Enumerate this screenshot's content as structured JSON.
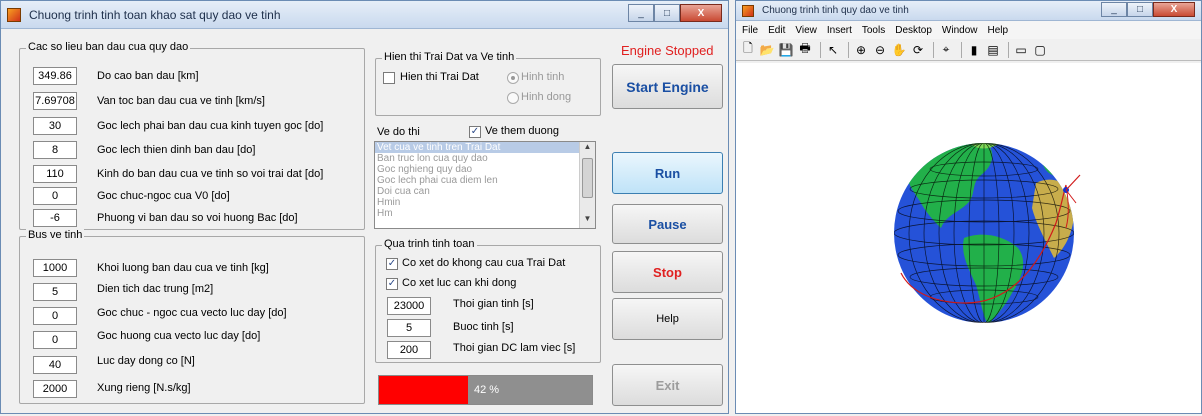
{
  "left_window": {
    "title": "Chuong trinh tinh toan khao sat quy dao ve tinh",
    "orbit_group": {
      "title": "Cac so lieu ban dau cua quy dao",
      "rows": [
        {
          "value": "349.86",
          "label": "Do cao ban dau [km]"
        },
        {
          "value": "7.69708",
          "label": "Van toc ban dau cua ve tinh [km/s]"
        },
        {
          "value": "30",
          "label": "Goc lech phai ban dau cua kinh tuyen goc [do]"
        },
        {
          "value": "8",
          "label": "Goc lech thien dinh ban dau [do]"
        },
        {
          "value": "110",
          "label": "Kinh do ban dau cua ve tinh so voi trai dat [do]"
        },
        {
          "value": "0",
          "label": "Goc chuc-ngoc cua V0 [do]"
        },
        {
          "value": "-6",
          "label": "Phuong vi ban dau so voi huong Bac [do]"
        }
      ]
    },
    "bus_group": {
      "title": "Bus ve tinh",
      "rows": [
        {
          "value": "1000",
          "label": "Khoi luong ban dau cua ve tinh [kg]"
        },
        {
          "value": "5",
          "label": "Dien tich dac trung [m2]"
        },
        {
          "value": "0",
          "label": "Goc chuc - ngoc cua vecto luc day [do]"
        },
        {
          "value": "0",
          "label": "Goc huong cua vecto luc day [do]"
        },
        {
          "value": "40",
          "label": "Luc day dong co [N]"
        },
        {
          "value": "2000",
          "label": "Xung rieng [N.s/kg]"
        }
      ]
    },
    "display_group": {
      "title": "Hien thi Trai Dat va Ve tinh",
      "show_earth": "Hien thi Trai Dat",
      "radio_static": "Hinh tinh",
      "radio_dynamic": "Hinh dong"
    },
    "plot_group": {
      "label": "Ve do thi",
      "overlay_check": "Ve them duong",
      "items": [
        "Vet cua ve tinh tren Trai Dat",
        "Ban truc lon cua quy dao",
        "Goc nghieng quy dao",
        "Goc lech phai cua diem len",
        "Doi cua can",
        "Hmin",
        "Hm"
      ]
    },
    "calc_group": {
      "title": "Qua trinh tinh toan",
      "check_oblateness": "Co xet do khong cau cua Trai Dat",
      "check_drag": "Co xet luc can khi dong",
      "rows": [
        {
          "value": "23000",
          "label": "Thoi gian tinh [s]"
        },
        {
          "value": "5",
          "label": "Buoc tinh [s]"
        },
        {
          "value": "200",
          "label": "Thoi gian DC lam viec [s]"
        }
      ]
    },
    "status": "Engine Stopped",
    "buttons": {
      "start": "Start Engine",
      "run": "Run",
      "pause": "Pause",
      "stop": "Stop",
      "help": "Help",
      "exit": "Exit"
    },
    "progress": {
      "value": 0.42,
      "label": "42 %"
    },
    "colors": {
      "status": "#e02020",
      "start": "#1a4fa3",
      "stop": "#e02020",
      "progress": "#ff0000"
    }
  },
  "right_window": {
    "title": "Chuong trinh tinh quy dao ve tinh",
    "menu": [
      "File",
      "Edit",
      "View",
      "Insert",
      "Tools",
      "Desktop",
      "Window",
      "Help"
    ]
  }
}
